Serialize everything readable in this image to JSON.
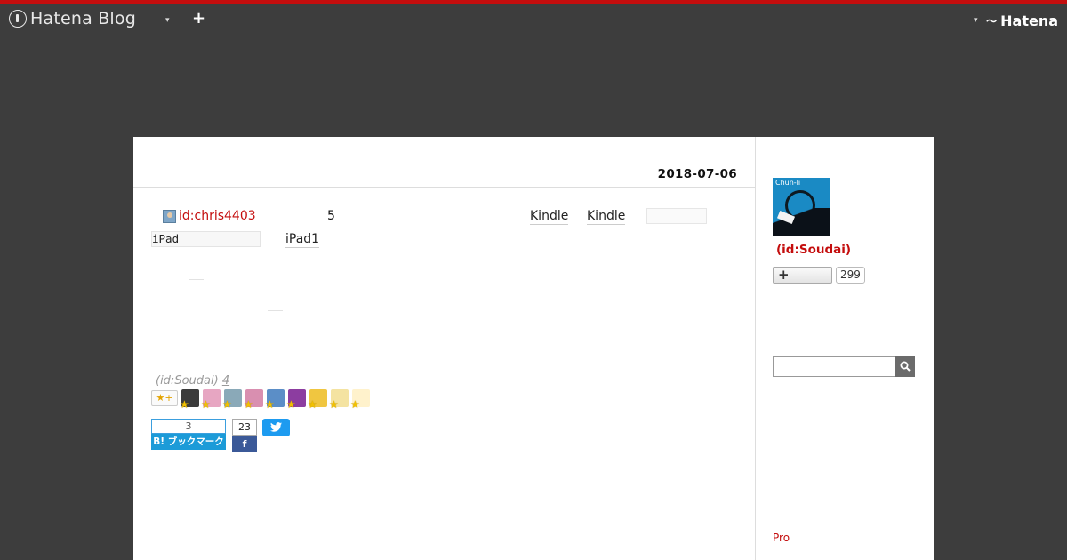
{
  "header": {
    "brand": "Hatena Blog",
    "caret1": "▾",
    "add_label": "+",
    "caret2": "▾",
    "service_mark": "〜",
    "service_name": "Hatena",
    "accent_color": "#c40d0d"
  },
  "entry": {
    "date": "2018-07-06",
    "author_id": "id:chris4403",
    "number": "5",
    "kindle_a": "Kindle",
    "kindle_b": "Kindle",
    "code_text": "iPad",
    "ipad1": "iPad1",
    "star_owner": "(id:Soudai)",
    "star_count": "4",
    "star_add_label": "★+",
    "star_users": [
      {
        "color": "#3b3b3b"
      },
      {
        "color": "#e7a6c2"
      },
      {
        "color": "#8aa9b8"
      },
      {
        "color": "#d98fb0"
      },
      {
        "color": "#5b8ec7"
      },
      {
        "color": "#8c3da0"
      },
      {
        "color": "#f0c640"
      },
      {
        "color": "#f4e3a1"
      },
      {
        "color": "#e5b07b"
      },
      {
        "color": "#fff2cc"
      }
    ],
    "hatebu_count": "3",
    "hatebu_label": "B! ブックマーク",
    "fb_count": "23",
    "fb_label": "f",
    "tw_label": "🐦"
  },
  "sidebar": {
    "avatar_label": "Chun-li",
    "name": "(id:Soudai)",
    "follow_label": "+",
    "follow_count": "299",
    "search_placeholder": "",
    "search_icon": "search-icon",
    "pro_label": "Pro"
  }
}
